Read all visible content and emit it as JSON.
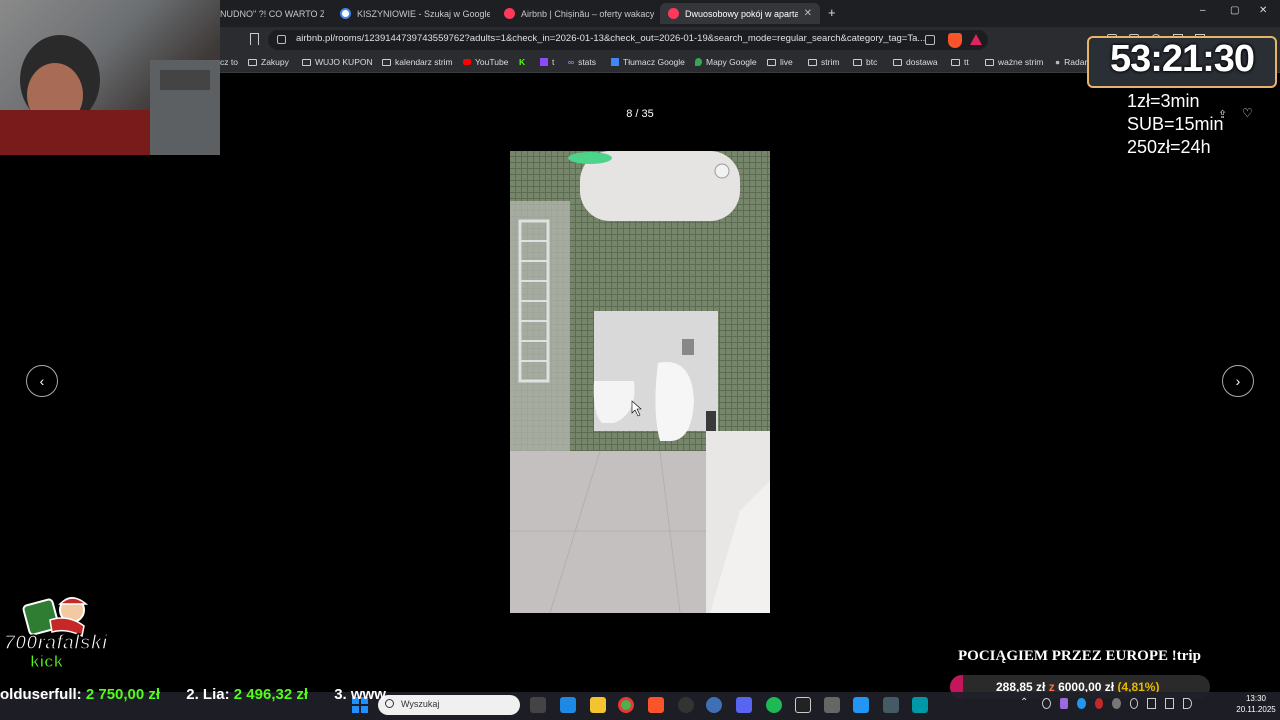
{
  "browser": {
    "tabs": [
      {
        "label": "NUDNO\" ?! CO WARTO ZOB",
        "active": false
      },
      {
        "label": "KISZYNIOWIE - Szukaj w Google",
        "active": false
      },
      {
        "label": "Airbnb | Chișinău – oferty wakacyjne",
        "active": false
      },
      {
        "label": "Dwuosobowy pokój w apartame",
        "active": true
      }
    ],
    "url": "airbnb.pl/rooms/1239144739743559762?adults=1&check_in=2026-01-13&check_out=2026-01-19&search_mode=regular_search&category_tag=Ta...",
    "bookmarks": [
      "cz to",
      "Zakupy",
      "WUJO KUPON",
      "kalendarz strim",
      "YouTube",
      "t",
      "stats",
      "Tłumacz Google",
      "Mapy Google",
      "live",
      "strim",
      "btc",
      "dostawa",
      "tt",
      "ważne strim",
      "Radar"
    ]
  },
  "gallery": {
    "counter": "8 / 35",
    "prev_icon": "‹",
    "next_icon": "›"
  },
  "stream": {
    "timer": "53:21:30",
    "rules": [
      "1zł=3min",
      "SUB=15min",
      "250zł=24h"
    ],
    "channel": "700rafalski",
    "platform": "kick",
    "goal_title": "POCIĄGIEM PRZEZ EUROPE !trip",
    "goal_current": "288,85 zł",
    "goal_sep": "z",
    "goal_target": "6000,00 zł",
    "goal_percent": "(4,81%)",
    "goal_fraction": 0.0481,
    "ticker": {
      "first_name": "olduserfull:",
      "first_amount": "2 750,00 zł",
      "second_name": "2. Lia:",
      "second_amount": "2 496,32 zł",
      "third_name": "3. www"
    }
  },
  "taskbar": {
    "search_placeholder": "Wyszukaj",
    "time": "13:30",
    "date": "20.11.2025"
  }
}
